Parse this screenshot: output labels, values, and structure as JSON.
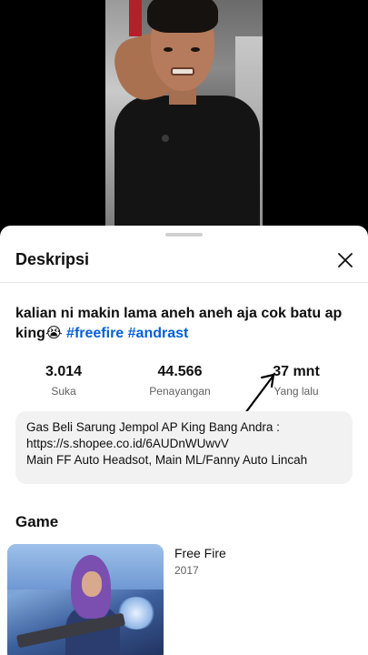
{
  "sheet": {
    "title": "Deskripsi",
    "close_icon": "close-icon"
  },
  "description": {
    "title_text": "kalian ni makin lama aneh aneh aja cok batu ap king😭",
    "hashtags": [
      "#freefire",
      "#andrast"
    ]
  },
  "stats": [
    {
      "value": "3.014",
      "label": "Suka"
    },
    {
      "value": "44.566",
      "label": "Penayangan"
    },
    {
      "value": "37 mnt",
      "label": "Yang lalu"
    }
  ],
  "description_box": {
    "lines": [
      "Gas Beli Sarung Jempol AP King Bang Andra :",
      "https://s.shopee.co.id/6AUDnWUwvV",
      "Main FF Auto Headsot, Main ML/Fanny Auto Lincah"
    ]
  },
  "game": {
    "heading": "Game",
    "name": "Free Fire",
    "year": "2017"
  },
  "colors": {
    "hashtag": "#065fd4",
    "sheet_bg": "#ffffff",
    "box_bg": "#f2f2f2"
  }
}
